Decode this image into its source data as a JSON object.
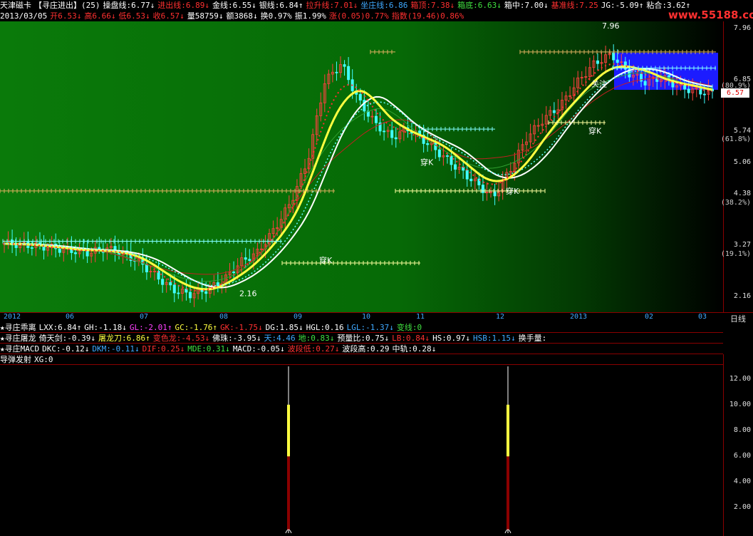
{
  "header": {
    "line1": [
      {
        "t": "天津磁卡",
        "c": "#ffffff"
      },
      {
        "t": "【寻庄进出】(25)",
        "c": "#ffffff"
      },
      {
        "t": "操盘线:6.77↓",
        "c": "#ffffff"
      },
      {
        "t": "进出线:6.89↓",
        "c": "#ff3030"
      },
      {
        "t": "金线:6.55↓",
        "c": "#ffffff"
      },
      {
        "t": "银线:6.84↑",
        "c": "#ffffff"
      },
      {
        "t": "拉升线:7.01↓",
        "c": "#ff3030"
      },
      {
        "t": "坐庄线:6.86",
        "c": "#3fa9ff"
      },
      {
        "t": "箱顶:7.38↓",
        "c": "#ff3030"
      },
      {
        "t": "箱底:6.63↓",
        "c": "#40e040"
      },
      {
        "t": "箱中:7.00↓",
        "c": "#ffffff"
      },
      {
        "t": "基准线:7.25",
        "c": "#ff3030"
      },
      {
        "t": "JG:-5.09↑",
        "c": "#ffffff"
      },
      {
        "t": "粘合:3.62↑",
        "c": "#ffffff"
      }
    ],
    "line2": [
      {
        "t": "2013/03/05",
        "c": "#ffffff"
      },
      {
        "t": "开6.53↓",
        "c": "#ff3030"
      },
      {
        "t": "高6.66↓",
        "c": "#ff3030"
      },
      {
        "t": "低6.53↓",
        "c": "#ff3030"
      },
      {
        "t": "收6.57↓",
        "c": "#ff3030"
      },
      {
        "t": "量58759↓",
        "c": "#ffffff"
      },
      {
        "t": "额3868↓",
        "c": "#ffffff"
      },
      {
        "t": "换0.97%",
        "c": "#ffffff"
      },
      {
        "t": "振1.99%",
        "c": "#ffffff"
      },
      {
        "t": "涨(0.05)0.77%",
        "c": "#ff3030"
      },
      {
        "t": "指数(19.46)0.86%",
        "c": "#ff3030"
      }
    ],
    "watermark": "www.55188.com"
  },
  "price_axis": {
    "labels": [
      {
        "v": "7.96",
        "p": 7.96
      },
      {
        "v": "6.85",
        "p": 6.85
      },
      {
        "v": "(80.9%)",
        "p": 6.7,
        "pct": true
      },
      {
        "v": "5.74",
        "p": 5.74
      },
      {
        "v": "(61.8%)",
        "p": 5.55,
        "pct": true
      },
      {
        "v": "5.06",
        "p": 5.06
      },
      {
        "v": "4.38",
        "p": 4.38
      },
      {
        "v": "(38.2%)",
        "p": 4.18,
        "pct": true
      },
      {
        "v": "3.27",
        "p": 3.27
      },
      {
        "v": "(19.1%)",
        "p": 3.07,
        "pct": true
      },
      {
        "v": "2.16",
        "p": 2.16
      }
    ],
    "current": "6.57",
    "min": 2.0,
    "max": 8.05
  },
  "chart_data": [
    {
      "type": "candlestick",
      "title": "天津磁卡 寻庄进出",
      "x_ticks": [
        "2012",
        "06",
        "07",
        "08",
        "09",
        "10",
        "11",
        "12",
        "2013",
        "02",
        "03"
      ],
      "ylim": [
        2.16,
        7.96
      ],
      "annotations": [
        "穿K",
        "穿K",
        "穿K",
        "穿K",
        "关注",
        "2.16",
        "7.96"
      ],
      "series": [
        {
          "name": "收盘价",
          "values": [
            3.3,
            3.28,
            3.25,
            3.2,
            3.15,
            3.1,
            3.2,
            3.1,
            2.9,
            2.6,
            2.3,
            2.2,
            2.3,
            2.5,
            2.9,
            3.1,
            3.6,
            4.2,
            5.1,
            6.8,
            7.2,
            6.4,
            5.9,
            5.6,
            5.8,
            5.5,
            5.2,
            4.9,
            4.6,
            4.3,
            4.9,
            5.6,
            6.0,
            6.3,
            6.8,
            7.2,
            7.4,
            7.0,
            6.8,
            6.9,
            6.7,
            6.6,
            6.57
          ]
        }
      ]
    },
    {
      "type": "bar",
      "title": "导弹发射",
      "categories": [
        "2012/10",
        "2012/12"
      ],
      "values": [
        13,
        13
      ],
      "ylim": [
        0,
        13
      ],
      "y_ticks": [
        2,
        4,
        6,
        8,
        10,
        12
      ]
    }
  ],
  "xaxis": {
    "ticks": [
      {
        "l": "2012",
        "x": 5
      },
      {
        "l": "06",
        "x": 92
      },
      {
        "l": "07",
        "x": 196
      },
      {
        "l": "08",
        "x": 308
      },
      {
        "l": "09",
        "x": 412
      },
      {
        "l": "10",
        "x": 508
      },
      {
        "l": "11",
        "x": 584
      },
      {
        "l": "12",
        "x": 696
      },
      {
        "l": "2013",
        "x": 800
      },
      {
        "l": "02",
        "x": 905
      },
      {
        "l": "03",
        "x": 980
      }
    ],
    "period": "日线"
  },
  "indicators": [
    {
      "items": [
        {
          "t": "★寻庄乖离",
          "c": "#ffffff"
        },
        {
          "t": "LXX:6.84↑",
          "c": "#ffffff"
        },
        {
          "t": "GH:-1.18↓",
          "c": "#ffffff"
        },
        {
          "t": "GL:-2.01↑",
          "c": "#ff40ff"
        },
        {
          "t": "GC:-1.76↑",
          "c": "#ffff40"
        },
        {
          "t": "GK:-1.75↓",
          "c": "#ff3030"
        },
        {
          "t": "DG:1.85↓",
          "c": "#ffffff"
        },
        {
          "t": "HGL:0.16",
          "c": "#ffffff"
        },
        {
          "t": "LGL:-1.37↓",
          "c": "#3fa9ff"
        },
        {
          "t": "变线:0",
          "c": "#40e040"
        }
      ]
    },
    {
      "items": [
        {
          "t": "★寻庄屠龙",
          "c": "#ffffff"
        },
        {
          "t": "倚天剑:-0.39↓",
          "c": "#ffffff"
        },
        {
          "t": "屠龙刀:6.86↑",
          "c": "#ffff40"
        },
        {
          "t": "变色龙:-4.53↓",
          "c": "#ff3030"
        },
        {
          "t": "佛珠:-3.95↓",
          "c": "#ffffff"
        },
        {
          "t": "天:4.46",
          "c": "#3fa9ff"
        },
        {
          "t": "地:0.83↓",
          "c": "#40e040"
        },
        {
          "t": "预量比:0.75↓",
          "c": "#ffffff"
        },
        {
          "t": "LB:0.84↓",
          "c": "#ff3030"
        },
        {
          "t": "HS:0.97↓",
          "c": "#ffffff"
        },
        {
          "t": "HSB:1.15↓",
          "c": "#3fa9ff"
        },
        {
          "t": "换手量:",
          "c": "#ffffff"
        }
      ]
    },
    {
      "items": [
        {
          "t": "★寻庄MACD",
          "c": "#ffffff"
        },
        {
          "t": "DKC:-0.12↓",
          "c": "#ffffff"
        },
        {
          "t": "DKM:-0.11↓",
          "c": "#3fa9ff"
        },
        {
          "t": "DIF:0.25↓",
          "c": "#ff3030"
        },
        {
          "t": "MDE:0.31↓",
          "c": "#40e040"
        },
        {
          "t": "MACD:-0.05↓",
          "c": "#ffffff"
        },
        {
          "t": "波段低:0.27↓",
          "c": "#ff3030"
        },
        {
          "t": "波段高:0.29",
          "c": "#ffffff"
        },
        {
          "t": "中轨:0.28↓",
          "c": "#ffffff"
        }
      ]
    },
    {
      "items": [
        {
          "t": "导弹发射",
          "c": "#ffffff"
        },
        {
          "t": "XG:0",
          "c": "#ffffff"
        }
      ]
    }
  ],
  "sub_axis": {
    "labels": [
      "12.00",
      "10.00",
      "8.00",
      "6.00",
      "4.00",
      "2.00"
    ]
  }
}
